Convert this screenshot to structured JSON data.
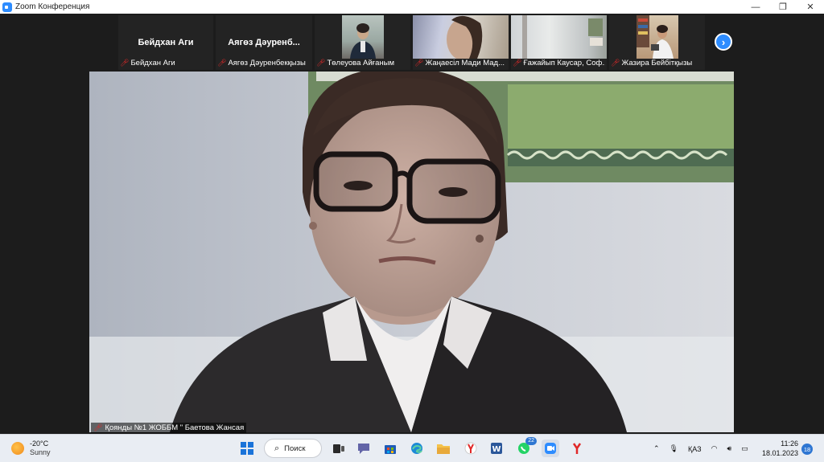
{
  "window": {
    "title": "Zoom Конференция",
    "controls": {
      "minimize": "—",
      "restore": "❐",
      "close": "✕"
    }
  },
  "gallery": {
    "tiles": [
      {
        "big_name": "Бейдхан Аги",
        "label": "Бейдхан Аги",
        "muted": true
      },
      {
        "big_name": "Аягөз Дәуренб...",
        "label": "Аягөз Дәуренбекқызы",
        "muted": true
      },
      {
        "big_name": "",
        "label": "Төлеуова Айғаным",
        "muted": true
      },
      {
        "big_name": "",
        "label": "Жаңаесіл Мади Мад...",
        "muted": true
      },
      {
        "big_name": "",
        "label": "Ғажайып Каусар, Соф...",
        "muted": true
      },
      {
        "big_name": "",
        "label": "Жазира Бейбітқызы",
        "muted": true
      }
    ],
    "next_icon": "›"
  },
  "main": {
    "speaker_label": "Қоянды №1 ЖОББМ \" Баетова Жансая"
  },
  "taskbar": {
    "weather": {
      "temp": "-20°C",
      "condition": "Sunny"
    },
    "search_label": "Поиск",
    "whatsapp_badge": "22",
    "language": "ҚАЗ",
    "time": "11:26",
    "date": "18.01.2023",
    "notifications": "18",
    "colors": {
      "accent": "#2d8cff",
      "muted_mic": "#e02828"
    }
  }
}
